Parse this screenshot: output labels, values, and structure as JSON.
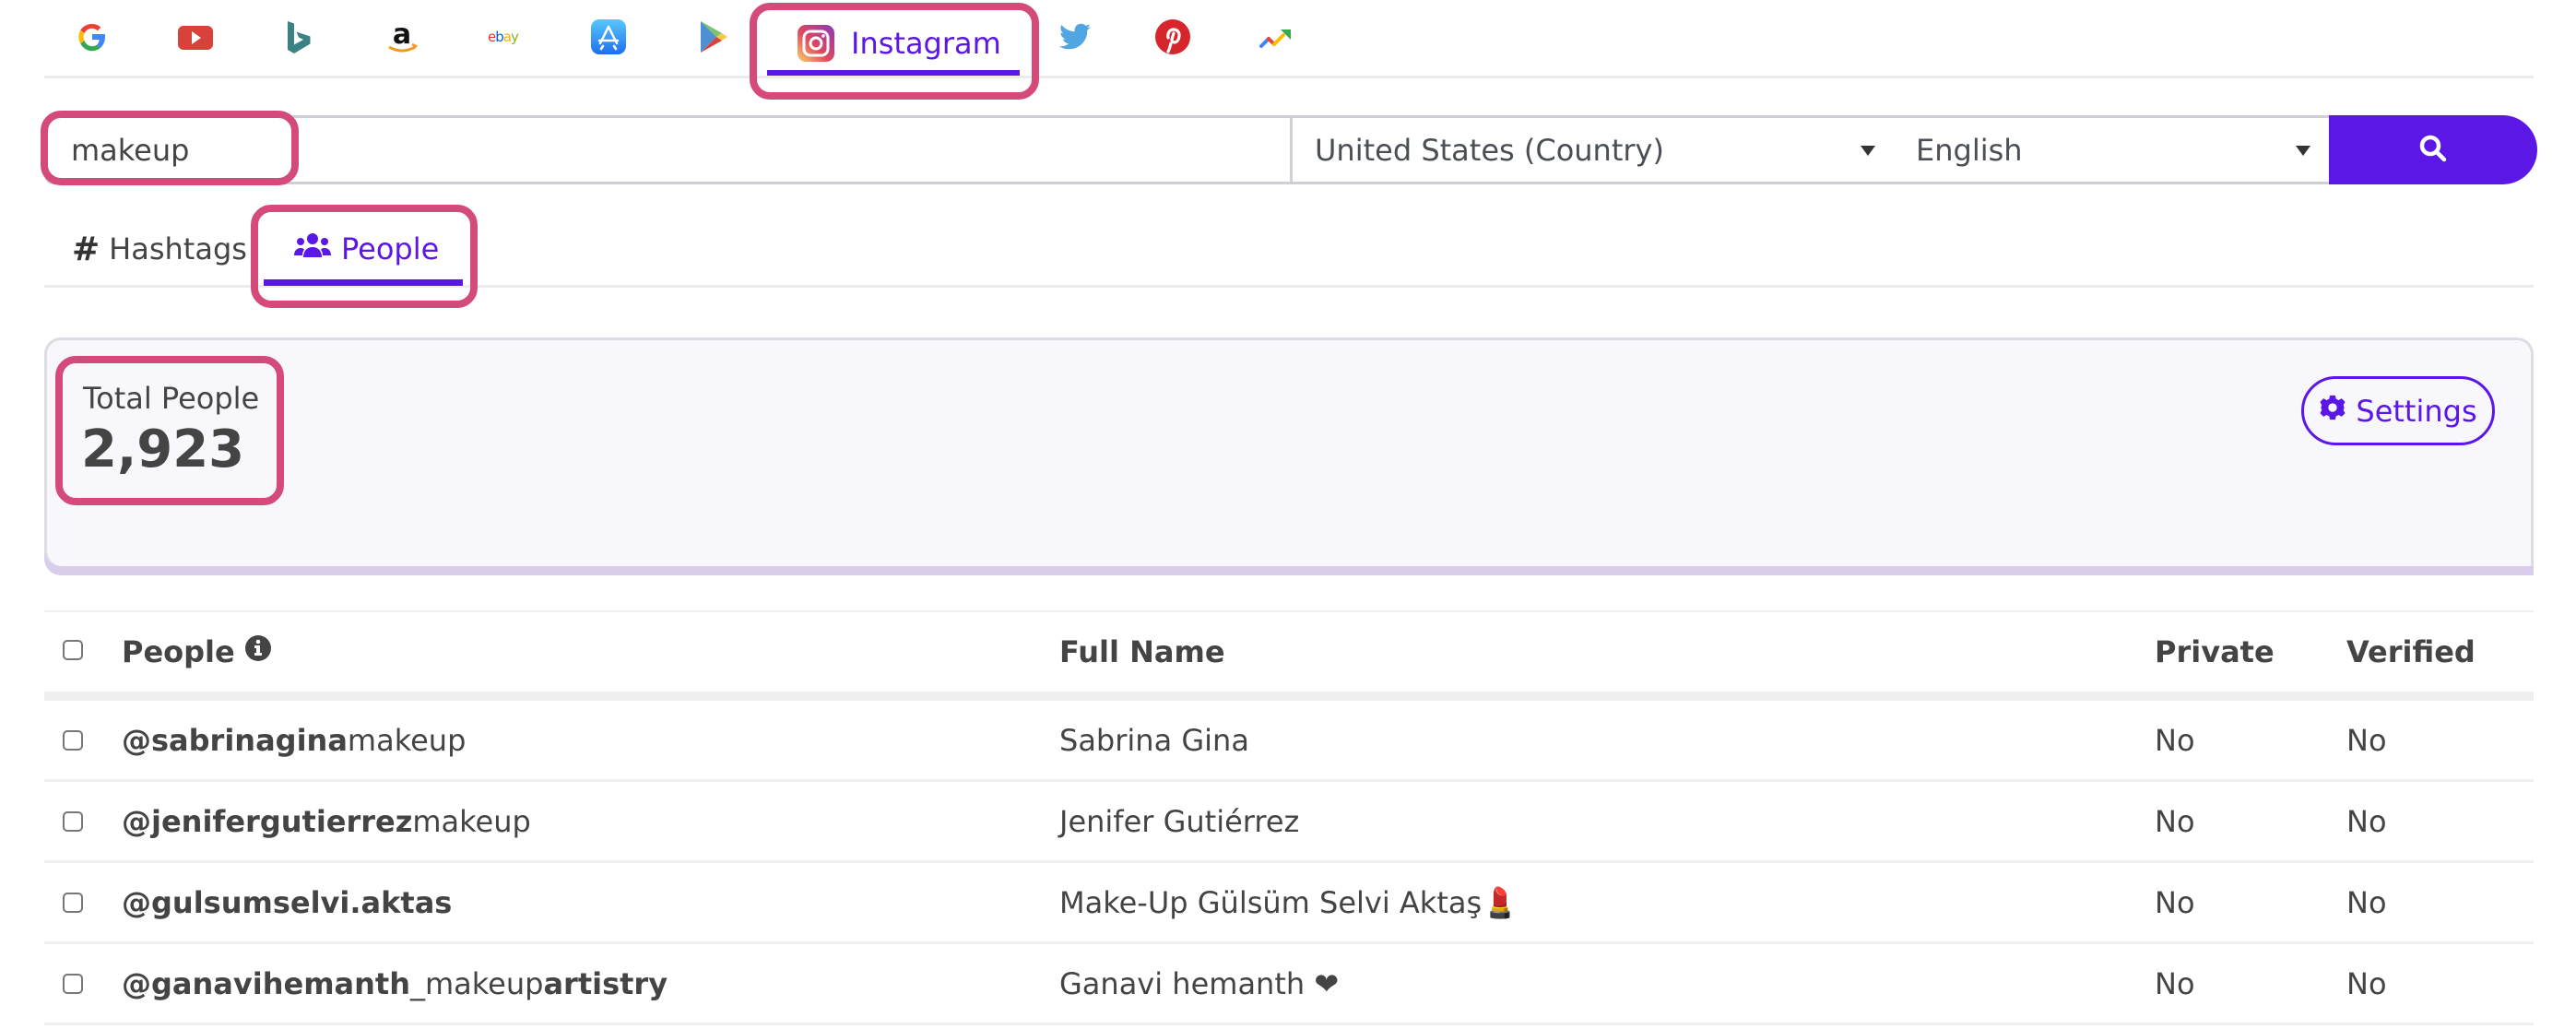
{
  "sources": {
    "items": [
      {
        "id": "google",
        "icon": "google-icon",
        "label": ""
      },
      {
        "id": "youtube",
        "icon": "youtube-icon",
        "label": ""
      },
      {
        "id": "bing",
        "icon": "bing-icon",
        "label": ""
      },
      {
        "id": "amazon",
        "icon": "amazon-icon",
        "label": ""
      },
      {
        "id": "ebay",
        "icon": "ebay-icon",
        "label": "ebay"
      },
      {
        "id": "appstore",
        "icon": "app-store-icon",
        "label": ""
      },
      {
        "id": "playstore",
        "icon": "play-store-icon",
        "label": ""
      },
      {
        "id": "instagram",
        "icon": "instagram-icon",
        "label": "Instagram",
        "active": true
      },
      {
        "id": "twitter",
        "icon": "twitter-icon",
        "label": ""
      },
      {
        "id": "pinterest",
        "icon": "pinterest-icon",
        "label": ""
      },
      {
        "id": "trends",
        "icon": "trends-icon",
        "label": ""
      }
    ],
    "active_label": "Instagram"
  },
  "search": {
    "query": "makeup",
    "country": "United States (Country)",
    "language": "English",
    "button_icon": "search-icon"
  },
  "tabs": {
    "hashtags": {
      "icon": "#",
      "label": "Hashtags"
    },
    "people": {
      "icon": "people-icon",
      "label": "People",
      "active": true
    }
  },
  "stats": {
    "label": "Total People",
    "value": "2,923",
    "settings_label": "Settings"
  },
  "table": {
    "headers": {
      "people": "People",
      "full_name": "Full Name",
      "private": "Private",
      "verified": "Verified"
    },
    "rows": [
      {
        "user_bold": "@sabrinagina",
        "user_rest": "makeup",
        "user_bold2": "",
        "full_name": "Sabrina Gina",
        "private": "No",
        "verified": "No"
      },
      {
        "user_bold": "@jenifergutierrez",
        "user_rest": "makeup",
        "user_bold2": "",
        "full_name": "Jenifer Gutiérrez",
        "private": "No",
        "verified": "No"
      },
      {
        "user_bold": "@gulsumselvi.aktas",
        "user_rest": "",
        "user_bold2": "",
        "full_name": "Make-Up Gülsüm Selvi Aktaş💄",
        "private": "No",
        "verified": "No"
      },
      {
        "user_bold": "@ganavihemanth",
        "user_rest": "_makeup",
        "user_bold2": "artistry",
        "full_name": "Ganavi hemanth ❤",
        "private": "No",
        "verified": "No"
      }
    ]
  },
  "colors": {
    "accent": "#5b17e6",
    "annotation": "#d44a7a",
    "card_bg": "#f8f7fc",
    "card_border_bottom": "#d8cdeb"
  }
}
